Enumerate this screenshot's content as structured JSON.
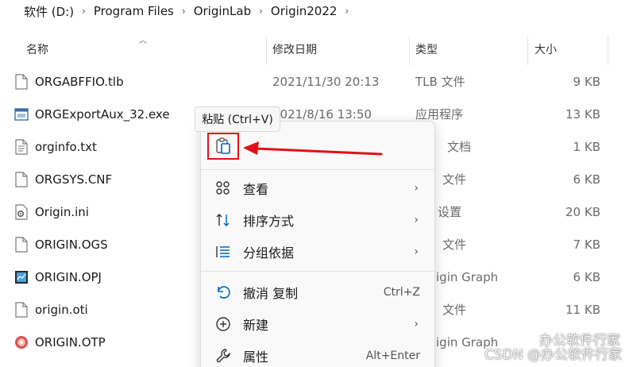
{
  "breadcrumb": {
    "items": [
      "软件 (D:)",
      "Program Files",
      "OriginLab",
      "Origin2022"
    ],
    "separator": "›"
  },
  "columns": {
    "name": "名称",
    "date": "修改日期",
    "type": "类型",
    "size": "大小"
  },
  "files": [
    {
      "name": "ORGABFFIO.tlb",
      "date": "2021/11/30 20:13",
      "type": "TLB 文件",
      "size": "9 KB",
      "icon": "file-icon"
    },
    {
      "name": "ORGExportAux_32.exe",
      "date": "2021/8/16 13:50",
      "type": "应用程序",
      "size": "13 KB",
      "icon": "exe-icon"
    },
    {
      "name": "orginfo.txt",
      "date": "",
      "type": "文档",
      "size": "1 KB",
      "icon": "text-file-icon"
    },
    {
      "name": "ORGSYS.CNF",
      "date": "",
      "type": "文件",
      "size": "6 KB",
      "icon": "file-icon"
    },
    {
      "name": "Origin.ini",
      "date": "",
      "type": "设置",
      "size": "20 KB",
      "icon": "settings-file-icon"
    },
    {
      "name": "ORIGIN.OGS",
      "date": "",
      "type": "文件",
      "size": "7 KB",
      "icon": "file-icon"
    },
    {
      "name": "ORIGIN.OPJ",
      "date": "",
      "type": "igin Graph",
      "size": "6 KB",
      "icon": "origin-project-icon"
    },
    {
      "name": "origin.oti",
      "date": "",
      "type": "文件",
      "size": "11 KB",
      "icon": "file-icon"
    },
    {
      "name": "ORIGIN.OTP",
      "date": "",
      "type": "igin Graph",
      "size": "",
      "icon": "origin-template-icon"
    }
  ],
  "tooltip": "粘贴 (Ctrl+V)",
  "menu": {
    "items": [
      {
        "label": "查看",
        "shortcut": "",
        "submenu": true,
        "icon": "grid-view-icon"
      },
      {
        "label": "排序方式",
        "shortcut": "",
        "submenu": true,
        "icon": "sort-icon"
      },
      {
        "label": "分组依据",
        "shortcut": "",
        "submenu": true,
        "icon": "group-icon"
      },
      {
        "label": "撤消 复制",
        "shortcut": "Ctrl+Z",
        "submenu": false,
        "icon": "undo-icon"
      },
      {
        "label": "新建",
        "shortcut": "",
        "submenu": true,
        "icon": "new-icon"
      },
      {
        "label": "属性",
        "shortcut": "Alt+Enter",
        "submenu": false,
        "icon": "wrench-icon"
      }
    ],
    "chevron": "›"
  },
  "watermark": {
    "line1": "办公软件行家",
    "line2": "CSDN @办公软件行家"
  },
  "colors": {
    "highlight": "#e0101a",
    "accent": "#0067c0"
  }
}
